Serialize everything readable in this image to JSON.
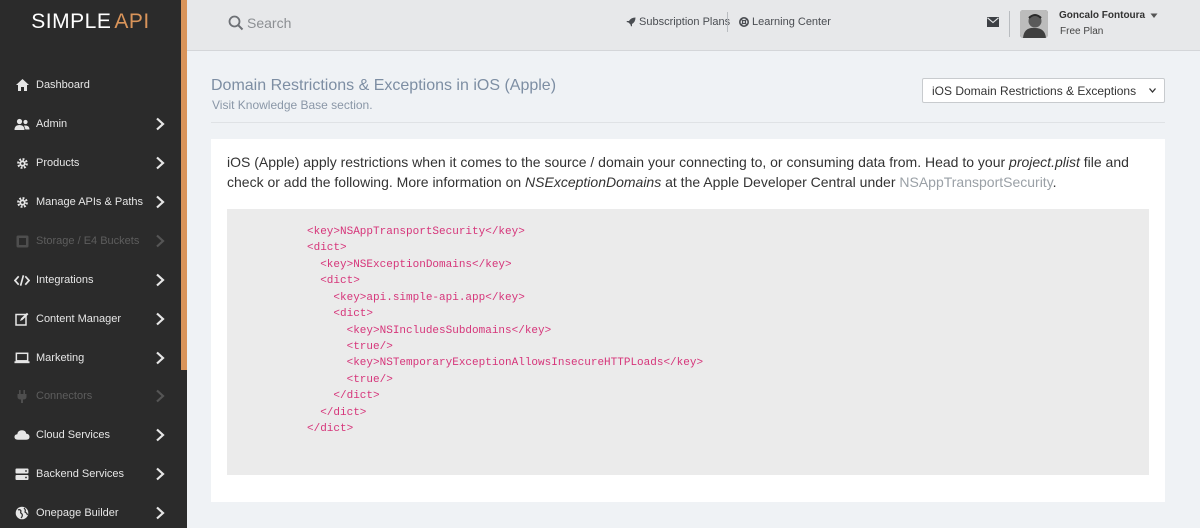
{
  "sidebar": {
    "logo": {
      "part1": "SIMPLE",
      "part2": "API"
    },
    "items": [
      {
        "label": "Dashboard",
        "icon": "home-icon",
        "has_chevron": false,
        "disabled": false
      },
      {
        "label": "Admin",
        "icon": "users-icon",
        "has_chevron": true,
        "disabled": false
      },
      {
        "label": "Products",
        "icon": "gear-icon",
        "has_chevron": true,
        "disabled": false
      },
      {
        "label": "Manage APIs & Paths",
        "icon": "gear-icon",
        "has_chevron": true,
        "disabled": false
      },
      {
        "label": "Storage / E4 Buckets",
        "icon": "storage-icon",
        "has_chevron": true,
        "disabled": true
      },
      {
        "label": "Integrations",
        "icon": "code-icon",
        "has_chevron": true,
        "disabled": false
      },
      {
        "label": "Content Manager",
        "icon": "edit-icon",
        "has_chevron": true,
        "disabled": false
      },
      {
        "label": "Marketing",
        "icon": "laptop-icon",
        "has_chevron": true,
        "disabled": false
      },
      {
        "label": "Connectors",
        "icon": "plug-icon",
        "has_chevron": true,
        "disabled": true
      },
      {
        "label": "Cloud Services",
        "icon": "cloud-icon",
        "has_chevron": true,
        "disabled": false
      },
      {
        "label": "Backend Services",
        "icon": "server-icon",
        "has_chevron": true,
        "disabled": false
      },
      {
        "label": "Onepage Builder",
        "icon": "globe-icon",
        "has_chevron": true,
        "disabled": false
      }
    ]
  },
  "topbar": {
    "search_placeholder": "Search",
    "links": [
      {
        "label": "Subscription Plans",
        "icon": "rocket-icon"
      },
      {
        "label": "Learning Center",
        "icon": "lifebuoy-icon"
      }
    ],
    "user": {
      "name": "Goncalo Fontoura",
      "plan": "Free Plan"
    }
  },
  "page": {
    "title": "Domain Restrictions & Exceptions in iOS (Apple)",
    "subtitle": "Visit Knowledge Base section.",
    "select_value": "iOS Domain Restrictions & Exceptions"
  },
  "content": {
    "intro_1": "iOS (Apple) apply restrictions when it comes to the source / domain your connecting to, or consuming data from. Head to your ",
    "intro_file": "project.plist",
    "intro_2": " file and check or add the following. More information on ",
    "intro_key": "NSExceptionDomains",
    "intro_3": " at the Apple Developer Central under ",
    "intro_link": "NSAppTransportSecurity",
    "intro_4": ".",
    "code_lines": [
      "<key>NSAppTransportSecurity</key>",
      "<dict>",
      "  <key>NSExceptionDomains</key>",
      "  <dict>",
      "    <key>api.simple-api.app</key>",
      "    <dict>",
      "      <key>NSIncludesSubdomains</key>",
      "      <true/>",
      "      <key>NSTemporaryExceptionAllowsInsecureHTTPLoads</key>",
      "      <true/>",
      "    </dict>",
      "  </dict>",
      "</dict>"
    ]
  },
  "colors": {
    "accent": "#d9945a",
    "sidebar_bg": "#2b2b2b",
    "code_text": "#d6357a"
  }
}
